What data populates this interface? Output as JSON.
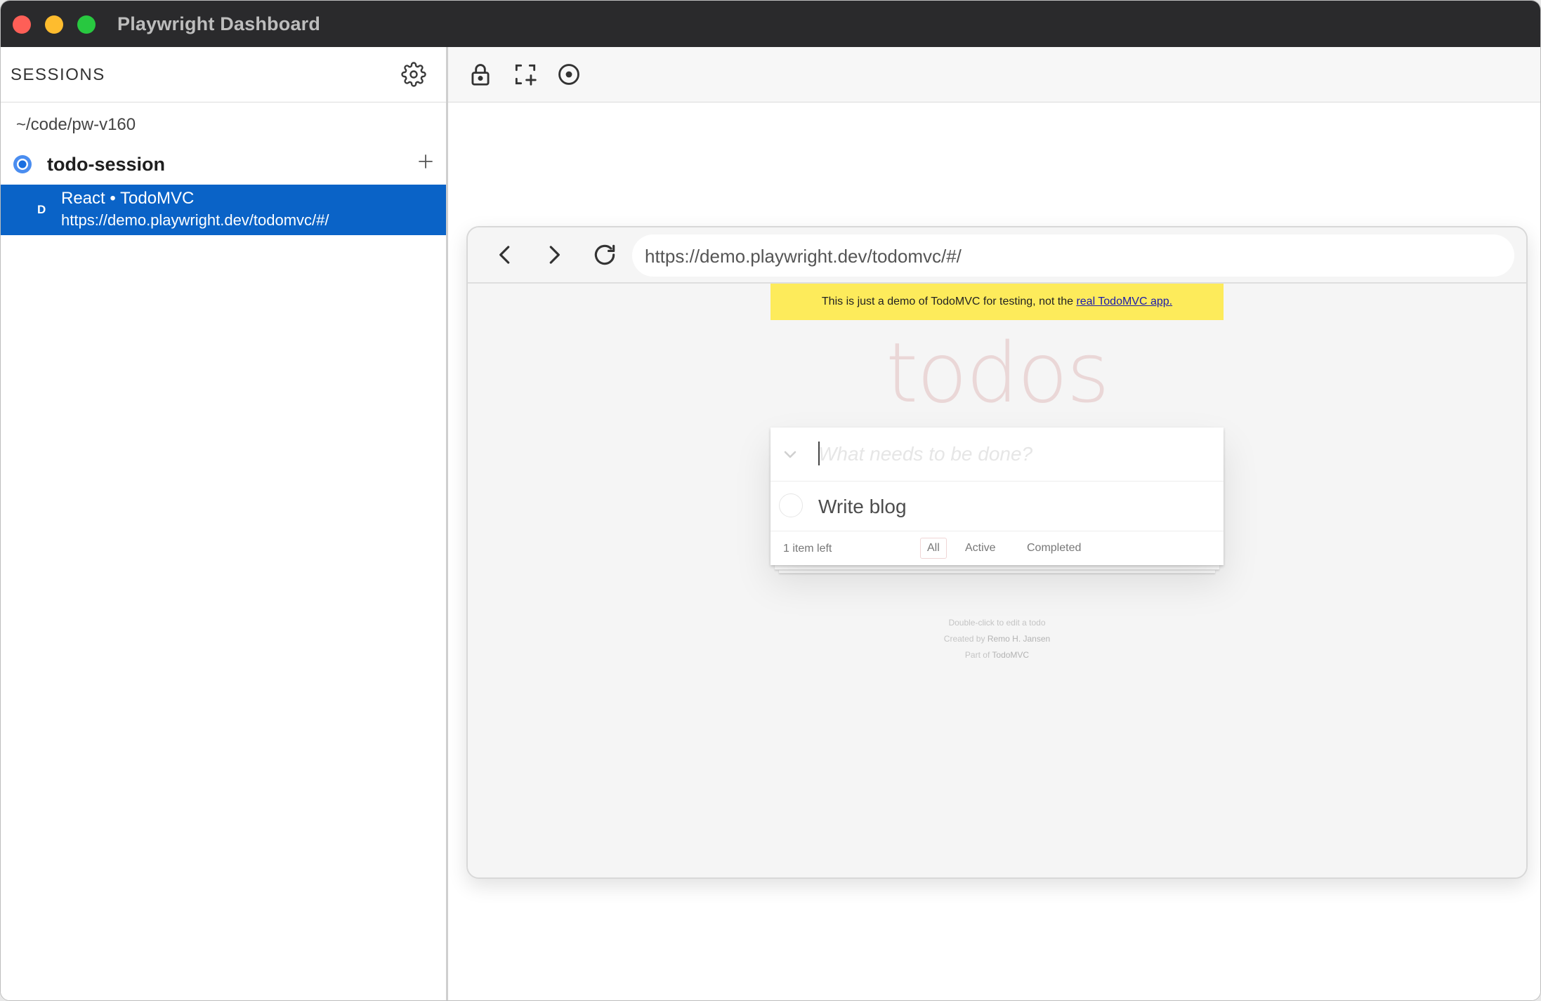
{
  "window": {
    "title": "Playwright Dashboard"
  },
  "sidebar": {
    "title": "SESSIONS",
    "workspace_path": "~/code/pw-v160",
    "session": {
      "name": "todo-session",
      "page": {
        "badge": "D",
        "title": "React • TodoMVC",
        "url": "https://demo.playwright.dev/todomvc/#/"
      }
    }
  },
  "browser": {
    "url": "https://demo.playwright.dev/todomvc/#/",
    "page": {
      "banner_text": "This is just a demo of TodoMVC for testing, not the ",
      "banner_link": "real TodoMVC app.",
      "heading": "todos",
      "new_todo_placeholder": "What needs to be done?",
      "todos": [
        {
          "label": "Write blog",
          "completed": false
        }
      ],
      "footer": {
        "count": "1 item left",
        "filters": [
          "All",
          "Active",
          "Completed"
        ],
        "selected_filter": "All"
      },
      "info": {
        "line1": "Double-click to edit a todo",
        "line2_prefix": "Created by ",
        "line2_author": "Remo H. Jansen",
        "line3_prefix": "Part of ",
        "line3_link": "TodoMVC"
      }
    }
  },
  "colors": {
    "selected_row": "#0a63c7",
    "banner": "#fdeb5b",
    "titlebar": "#2a2a2c"
  },
  "icons": {
    "toolbar": [
      "lock-icon",
      "pick-locator-icon",
      "record-icon"
    ],
    "browser_nav": [
      "back-icon",
      "forward-icon",
      "reload-icon"
    ]
  }
}
